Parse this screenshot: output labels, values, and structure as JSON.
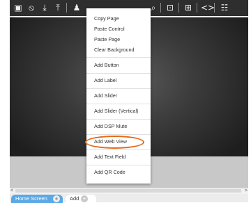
{
  "toolbar": {
    "tools": [
      {
        "icon": "image-icon",
        "glyph": "▣"
      },
      {
        "icon": "clear-icon",
        "glyph": "⃠"
      },
      {
        "icon": "download-icon",
        "glyph": "⭳"
      },
      {
        "icon": "upload-icon",
        "glyph": "⭱"
      },
      {
        "icon": "person-icon",
        "glyph": "♟"
      },
      {
        "icon": "zoom-icon",
        "glyph": "⌕"
      },
      {
        "icon": "lock-icon",
        "glyph": "🔒"
      },
      {
        "icon": "grid-icon",
        "glyph": "⊞"
      },
      {
        "icon": "code-icon",
        "glyph": "<>"
      },
      {
        "icon": "sliders-icon",
        "glyph": "⚌"
      }
    ]
  },
  "context_menu": {
    "items": [
      {
        "label": "Copy Page"
      },
      {
        "label": "Paste Control"
      },
      {
        "label": "Paste Page"
      },
      {
        "label": "Clear Background"
      },
      {
        "label": "Add Button"
      },
      {
        "label": "Add Label"
      },
      {
        "label": "Add Slider"
      },
      {
        "label": "Add Slider (Vertical)"
      },
      {
        "label": "Add DSP Mute"
      },
      {
        "label": "Add Web View"
      },
      {
        "label": "Add Text Field"
      },
      {
        "label": "Add QR Code"
      }
    ],
    "highlighted_item": "Add Web View",
    "highlight_color": "#e86a18"
  },
  "tabs": {
    "items": [
      {
        "label": "Home Screen",
        "active": true
      },
      {
        "label": "Add",
        "active": false
      }
    ],
    "close_glyph": "●",
    "add_glyph": "+"
  },
  "scrollbar": {
    "left_arrow": "<",
    "right_arrow": ">"
  },
  "colors": {
    "toolbar_bg": "#2e2e2e",
    "canvas_center": "#5a5a5a",
    "tab_active": "#5aa9e6",
    "menu_bg": "#ffffff"
  }
}
